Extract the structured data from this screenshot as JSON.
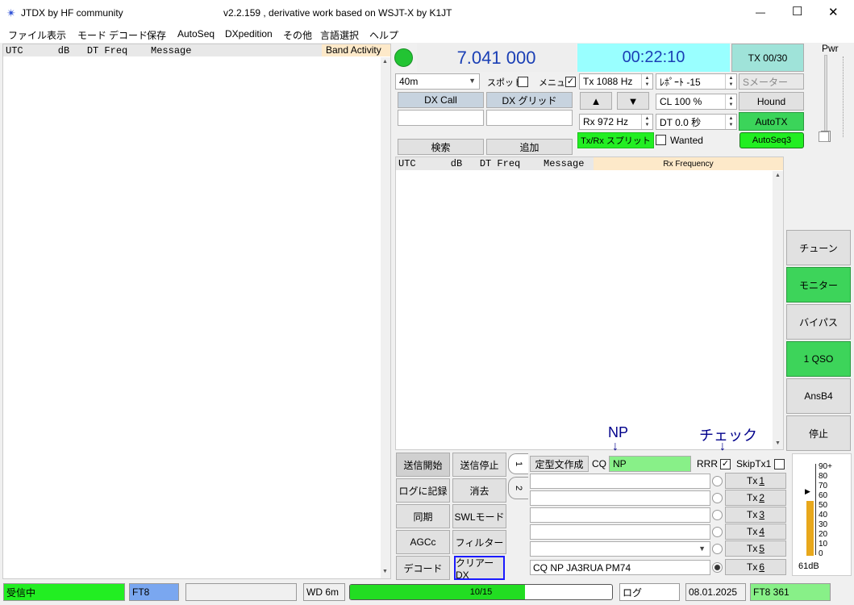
{
  "window": {
    "app_name": "JTDX  by HF community",
    "subtitle": "v2.2.159 , derivative work based on WSJT-X by K1JT",
    "minimize": "—",
    "maximize": "☐",
    "close": "✕"
  },
  "menu": [
    "ファイル",
    "表示",
    "モード",
    "デコード",
    "保存",
    "AutoSeq",
    "DXpedition",
    "その他",
    "言語選択",
    "ヘルプ"
  ],
  "band_activity": {
    "header": "UTC      dB   DT Freq    Message",
    "title": "Band Activity"
  },
  "freq_display": "7.041 000",
  "time_display": "00:22:10",
  "tx_counter": "TX 00/30",
  "pwr_label": "Pwr",
  "band_select": "40m",
  "spot_label": "スポット",
  "menu_label": "メニュー",
  "menu_check": "✓",
  "tx_hz": "Tx  1088  Hz",
  "report": "ﾚﾎﾟｰﾄ -15",
  "smeter": "Sメーター",
  "dx_call_label": "DX Call",
  "dx_grid_label": "DX グリッド",
  "dx_call_value": "",
  "dx_grid_value": "",
  "up_arrow": "▲",
  "down_arrow": "▼",
  "cl": "CL  100 %",
  "hound": "Hound",
  "rx_hz": "Rx  972  Hz",
  "dt": "DT 0.0 秒",
  "autotx": "AutoTX",
  "search": "検索",
  "add": "追加",
  "txrx_split": "Tx/Rx スプリット",
  "wanted": "Wanted",
  "autoseq3": "AutoSeq3",
  "rx_frequency": {
    "header": "UTC      dB   DT Freq    Message",
    "title": "Rx Frequency"
  },
  "right_buttons": [
    "チューン",
    "モニター",
    "バイパス",
    "1 QSO",
    "AnsB4",
    "停止"
  ],
  "annotations": {
    "np": "NP",
    "check": "チェック",
    "arrow": "↓"
  },
  "ctrl_buttons": [
    "送信開始",
    "送信停止",
    "ログに記録",
    "消去",
    "同期",
    "SWLモード",
    "AGCc",
    "フィルター",
    "デコード",
    "クリアーDX"
  ],
  "tab1": "1",
  "tab2": "2",
  "std_msg": "定型文作成",
  "cq_label": "CQ",
  "cq_value": "NP",
  "rrr": "RRR",
  "rrr_check": "✓",
  "skiptx1": "SkipTx1",
  "tx_buttons": [
    {
      "pre": "Tx ",
      "num": "1"
    },
    {
      "pre": "Tx ",
      "num": "2"
    },
    {
      "pre": "Tx ",
      "num": "3"
    },
    {
      "pre": "Tx ",
      "num": "4"
    },
    {
      "pre": "Tx ",
      "num": "5"
    },
    {
      "pre": "Tx ",
      "num": "6"
    }
  ],
  "tx6_msg": "CQ NP JA3RUA PM74",
  "level": {
    "ticks": [
      "90+",
      "80",
      "70",
      "60",
      "50",
      "40",
      "30",
      "20",
      "10",
      "0"
    ],
    "value_label": "61dB",
    "level_fraction": 0.61
  },
  "status": {
    "receiving": "受信中",
    "mode": "FT8",
    "empty": "",
    "wd": "WD 6m",
    "progress": "10/15",
    "progress_fraction": 0.6667,
    "log": "ログ",
    "date": "08.01.2025",
    "mode_num": "FT8  361"
  },
  "colors": {
    "green": "#22ee22",
    "light_cyan": "#99ffff",
    "blue_text": "#00008b",
    "tab_header_bg": "#fde9c9"
  }
}
